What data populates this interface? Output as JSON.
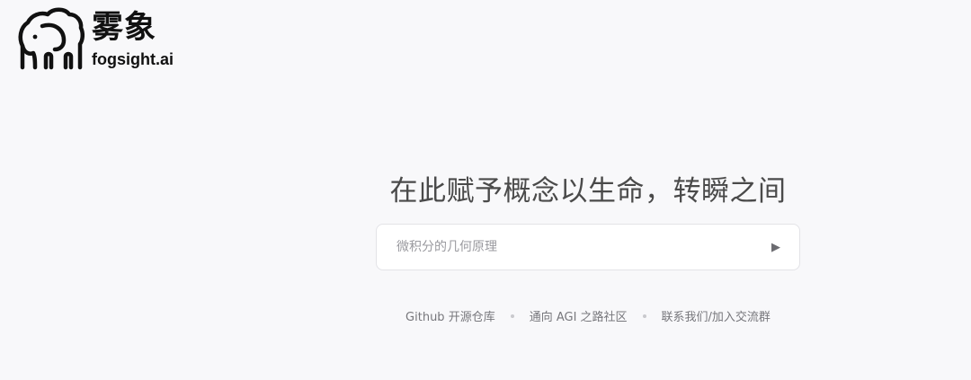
{
  "brand": {
    "name_cn": "雾象",
    "name_en": "fogsight.ai",
    "logo_icon": "elephant-cloud-icon"
  },
  "hero": {
    "slogan": "在此赋予概念以生命，转瞬之间"
  },
  "prompt": {
    "placeholder": "微积分的几何原理",
    "value": "",
    "send_icon": "play-triangle-icon",
    "send_glyph": "▶"
  },
  "footer": {
    "links": [
      {
        "label": "Github 开源仓库"
      },
      {
        "label": "通向 AGI 之路社区"
      },
      {
        "label": "联系我们/加入交流群"
      }
    ]
  },
  "colors": {
    "background": "#f8f8fa",
    "text_primary": "#111111",
    "slogan": "#4a4a4a",
    "link": "#77777c",
    "input_border": "#e3e3e7"
  }
}
